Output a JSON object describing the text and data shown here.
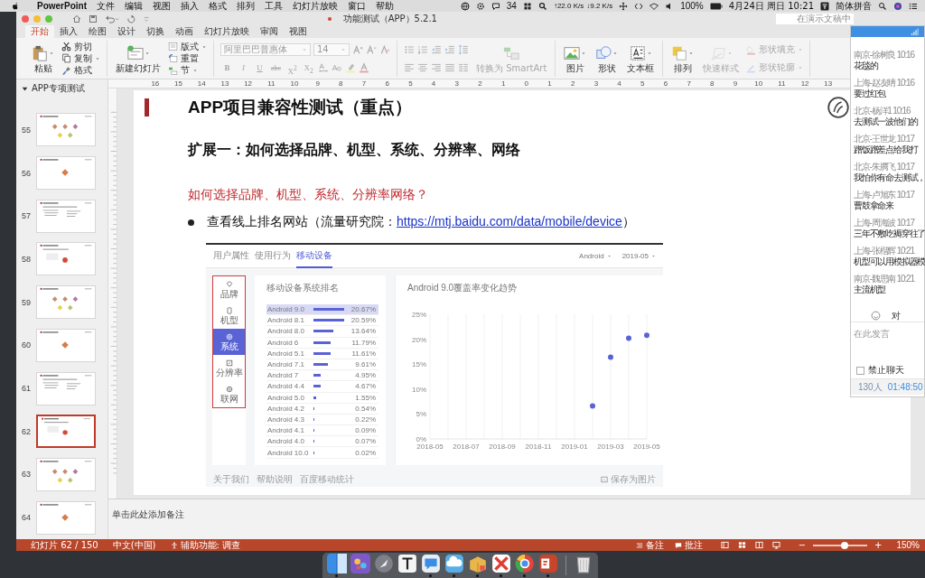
{
  "menubar": {
    "app": "PowerPoint",
    "menus": [
      "文件",
      "编辑",
      "视图",
      "插入",
      "格式",
      "排列",
      "工具",
      "幻灯片放映",
      "窗口",
      "帮助"
    ],
    "status": {
      "notifications": "34",
      "upload": "↑22.0 K/s",
      "download": "↓9.2 K/s",
      "battery": "100%",
      "datetime": "4月24日 周日 10:21",
      "input_method": "简体拼音"
    }
  },
  "window": {
    "title": "功能测试（APP）5.2.1",
    "search": {
      "placeholder": "在演示文稿中"
    }
  },
  "tabs": [
    {
      "label": "开始",
      "selected": true
    },
    {
      "label": "插入",
      "selected": false
    },
    {
      "label": "绘图",
      "selected": false
    },
    {
      "label": "设计",
      "selected": false
    },
    {
      "label": "切换",
      "selected": false
    },
    {
      "label": "动画",
      "selected": false
    },
    {
      "label": "幻灯片放映",
      "selected": false
    },
    {
      "label": "审阅",
      "selected": false
    },
    {
      "label": "视图",
      "selected": false
    }
  ],
  "ribbon": [
    {
      "columns": [
        [
          {
            "kind": "big",
            "label": "粘贴",
            "disabled": false,
            "dropdown": true
          }
        ],
        [
          {
            "kind": "small",
            "label": "剪切",
            "disabled": false,
            "dropdown": false
          },
          {
            "kind": "small",
            "label": "复制",
            "disabled": false,
            "dropdown": true
          },
          {
            "kind": "small",
            "label": "格式",
            "disabled": false,
            "dropdown": false
          }
        ]
      ]
    },
    {
      "columns": [
        [
          {
            "kind": "big",
            "label": "新建幻灯片",
            "disabled": false,
            "dropdown": true
          }
        ],
        [
          {
            "kind": "small",
            "label": "版式",
            "disabled": false,
            "dropdown": true
          },
          {
            "kind": "small",
            "label": "重置",
            "disabled": false,
            "dropdown": false
          },
          {
            "kind": "small",
            "label": "节",
            "disabled": false,
            "dropdown": true
          }
        ]
      ]
    },
    {
      "columns": [
        [
          {
            "kind": "row",
            "items": [
              {
                "kind": "field",
                "value": "阿里巴巴普惠体",
                "disabled": true
              },
              {
                "kind": "field",
                "value": "14",
                "disabled": true
              },
              {
                "kind": "icon",
                "disabled": true
              },
              {
                "kind": "icon",
                "disabled": true
              },
              {
                "kind": "icon",
                "disabled": true
              }
            ]
          },
          {
            "kind": "row",
            "items": [
              {
                "kind": "glyph",
                "label": "B",
                "disabled": true
              },
              {
                "kind": "glyph",
                "label": "I",
                "disabled": true
              },
              {
                "kind": "glyph",
                "label": "U",
                "disabled": true
              },
              {
                "kind": "glyph",
                "label": "abc",
                "disabled": true
              },
              {
                "kind": "glyph",
                "label": "X$^{2}$",
                "disabled": true
              },
              {
                "kind": "glyph",
                "label": "X$_{2}$",
                "disabled": true
              },
              {
                "kind": "icon",
                "disabled": true
              },
              {
                "kind": "icon",
                "disabled": true
              },
              {
                "kind": "icon",
                "disabled": true
              },
              {
                "kind": "icon",
                "disabled": true
              }
            ]
          }
        ]
      ]
    },
    {
      "columns": [
        [
          {
            "kind": "row",
            "items": [
              {
                "kind": "icon",
                "disabled": true
              },
              {
                "kind": "icon",
                "disabled": true
              },
              {
                "kind": "icon",
                "disabled": true
              },
              {
                "kind": "icon",
                "disabled": true
              },
              {
                "kind": "icon",
                "disabled": true
              }
            ]
          },
          {
            "kind": "row",
            "items": [
              {
                "kind": "icon",
                "disabled": true
              },
              {
                "kind": "icon",
                "disabled": true
              },
              {
                "kind": "icon",
                "disabled": true
              },
              {
                "kind": "icon",
                "disabled": true
              },
              {
                "kind": "icon",
                "disabled": true
              }
            ]
          }
        ],
        [
          {
            "kind": "big",
            "label": "转换为 SmartArt",
            "disabled": true,
            "dropdown": false
          }
        ]
      ]
    },
    {
      "columns": [
        [
          {
            "kind": "big",
            "label": "图片",
            "disabled": false,
            "dropdown": true
          }
        ],
        [
          {
            "kind": "big",
            "label": "形状",
            "disabled": false,
            "dropdown": true
          }
        ],
        [
          {
            "kind": "big",
            "label": "文本框",
            "disabled": false,
            "dropdown": true
          }
        ]
      ]
    },
    {
      "columns": [
        [
          {
            "kind": "big",
            "label": "排列",
            "disabled": false,
            "dropdown": true
          }
        ],
        [
          {
            "kind": "big",
            "label": "快速样式",
            "disabled": true,
            "dropdown": true
          }
        ],
        [
          {
            "kind": "small",
            "label": "形状填充",
            "disabled": true,
            "dropdown": true
          },
          {
            "kind": "small",
            "label": "形状轮廓",
            "disabled": true,
            "dropdown": true
          }
        ]
      ]
    }
  ],
  "ruler": [
    "16",
    "15",
    "14",
    "13",
    "12",
    "11",
    "10",
    "9",
    "8",
    "7",
    "6",
    "5",
    "4",
    "3",
    "2",
    "1",
    "0",
    "1",
    "2",
    "3",
    "4",
    "5",
    "6",
    "7",
    "8",
    "9",
    "10",
    "11",
    "12",
    "13"
  ],
  "slide_panel": {
    "section": "APP专项测试",
    "expanded": true,
    "slides": [
      {
        "number": "55",
        "selected": false
      },
      {
        "number": "56",
        "selected": false
      },
      {
        "number": "57",
        "selected": false
      },
      {
        "number": "58",
        "selected": false
      },
      {
        "number": "59",
        "selected": false
      },
      {
        "number": "60",
        "selected": false
      },
      {
        "number": "61",
        "selected": false
      },
      {
        "number": "62",
        "selected": true
      },
      {
        "number": "63",
        "selected": false
      },
      {
        "number": "64",
        "selected": false
      }
    ]
  },
  "slide": {
    "title": "APP项目兼容性测试（重点）",
    "subtitle": "扩展一：如何选择品牌、机型、系统、分辨率、网络",
    "question": "如何选择品牌、机型、系统、分辨率网络？",
    "bullet": {
      "text": "查看线上排名网站（流量研究院：",
      "link": "https://mtj.baidu.com/data/mobile/device",
      "suffix": "）"
    },
    "embedded_page": {
      "tabs": [
        {
          "label": "用户属性",
          "selected": false
        },
        {
          "label": "使用行为",
          "selected": false
        },
        {
          "label": "移动设备",
          "selected": true
        }
      ],
      "filters": [
        "Android",
        "2019-05"
      ],
      "nav": [
        {
          "label": "品牌",
          "selected": false
        },
        {
          "label": "机型",
          "selected": false
        },
        {
          "label": "系统",
          "selected": true
        },
        {
          "label": "分辨率",
          "selected": false
        },
        {
          "label": "联网",
          "selected": false
        }
      ],
      "ranking": {
        "title": "移动设备系统排名",
        "rows": [
          {
            "name": "Android 9.0",
            "share": "20.67%",
            "selected": true
          },
          {
            "name": "Android 8.1",
            "share": "20.59%",
            "selected": false
          },
          {
            "name": "Android 8.0",
            "share": "13.64%",
            "selected": false
          },
          {
            "name": "Android 6",
            "share": "11.79%",
            "selected": false
          },
          {
            "name": "Android 5.1",
            "share": "11.61%",
            "selected": false
          },
          {
            "name": "Android 7.1",
            "share": "9.61%",
            "selected": false
          },
          {
            "name": "Android 7",
            "share": "4.95%",
            "selected": false
          },
          {
            "name": "Android 4.4",
            "share": "4.67%",
            "selected": false
          },
          {
            "name": "Android 5.0",
            "share": "1.55%",
            "selected": false
          },
          {
            "name": "Android 4.2",
            "share": "0.54%",
            "selected": false
          },
          {
            "name": "Android 4.3",
            "share": "0.22%",
            "selected": false
          },
          {
            "name": "Android 4.1",
            "share": "0.09%",
            "selected": false
          },
          {
            "name": "Android 4.0",
            "share": "0.07%",
            "selected": false
          },
          {
            "name": "Android 10.0",
            "share": "0.02%",
            "selected": false
          }
        ]
      },
      "trend": {
        "chart_data": {
          "type": "scatter",
          "title": "Android 9.0覆盖率变化趋势",
          "categories": [
            "2018-05",
            null,
            "2018-07",
            null,
            "2018-09",
            null,
            "2018-11",
            null,
            "2019-01",
            null,
            "2019-03",
            null,
            "2019-05"
          ],
          "values": [
            null,
            null,
            null,
            null,
            null,
            null,
            null,
            null,
            null,
            6.6,
            16.4,
            20.2,
            20.8
          ],
          "ylim": [
            0,
            25
          ],
          "grid": true,
          "yticks": [
            {
              "value": 0,
              "label": "0%"
            },
            {
              "value": 5,
              "label": "5%"
            },
            {
              "value": 10,
              "label": "10%"
            },
            {
              "value": 15,
              "label": "15%"
            },
            {
              "value": 20,
              "label": "20%"
            },
            {
              "value": 25,
              "label": "25%"
            }
          ]
        }
      },
      "footer_links": [
        "关于我们",
        "帮助说明",
        "百度移动统计"
      ],
      "save": "保存为图片"
    }
  },
  "notes": {
    "placeholder": "单击此处添加备注"
  },
  "status_bar": {
    "slide": "幻灯片 62 / 150",
    "language": "中文(中国)",
    "accessibility": "辅助功能: 调查",
    "notes": "备注",
    "comments": "批注",
    "zoom_out": "−",
    "zoom_in": "+",
    "zoom": {
      "level": 0.58
    },
    "zoom_percent": "150%"
  },
  "chat": {
    "messages": [
      {
        "sender": "南京-徐树良",
        "time": "10:16",
        "text": "花毯的"
      },
      {
        "sender": "上海-赵友晴",
        "time": "10:16",
        "text": "要过红包"
      },
      {
        "sender": "北京-杨洋1",
        "time": "10:16",
        "text": "去测试一波他们的"
      },
      {
        "sender": "北京-王世龙",
        "time": "10:17",
        "text": "蹭饭蹭差点给我打"
      },
      {
        "sender": "北京-朱腾飞",
        "time": "10:17",
        "text": "我怕你有命去测试，"
      },
      {
        "sender": "上海-卢旭东",
        "time": "10:17",
        "text": "曹鼓拿命来"
      },
      {
        "sender": "上海-周海波",
        "time": "10:17",
        "text": "三年不敷吃褥穿往了"
      },
      {
        "sender": "上海-张楷辉",
        "time": "10:21",
        "text": "机型可以用模拟器模"
      },
      {
        "sender": "南京-魏思南",
        "time": "10:21",
        "text": "主流机型"
      }
    ],
    "recipient": "对",
    "input": {
      "placeholder": "在此发言"
    },
    "mute": {
      "label": "禁止聊天",
      "checked": false
    },
    "members": "130人",
    "timer": "01:48:50"
  },
  "dock": {
    "apps": [
      {
        "running": true
      },
      {
        "running": false
      },
      {
        "running": false
      },
      {
        "running": false
      },
      {
        "running": true
      },
      {
        "running": true
      },
      {
        "running": true
      },
      {
        "running": true
      },
      {
        "running": true
      },
      {
        "running": true
      }
    ]
  }
}
